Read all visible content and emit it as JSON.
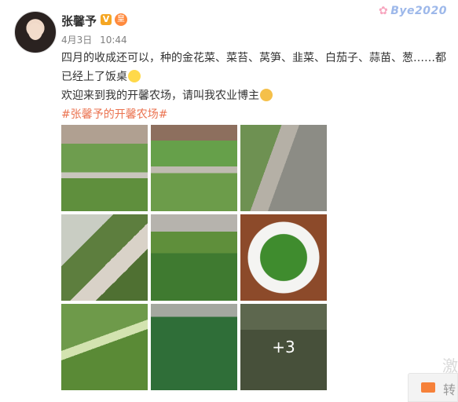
{
  "post": {
    "username": "张馨予",
    "verified_badge": "V",
    "member_badge": "皇",
    "date": "4月3日",
    "time": "10:44",
    "text_line1": "四月的收成还可以，种的金花菜、菜苔、莴笋、韭菜、白茄子、蒜苗、葱……都已经上了饭桌",
    "text_line2": "欢迎来到我的开馨农场，请叫我农业博主",
    "hashtag": "#张馨予的开馨农场#",
    "more_photos": "+3"
  },
  "top_right_logo": "Bye2020",
  "watermark_char": "激",
  "share_text": "转",
  "icons": [
    "avatar",
    "v-badge-icon",
    "member-badge-icon",
    "grin-emoji-icon",
    "cat-emoji-icon",
    "mail-icon"
  ],
  "colors": {
    "tag": "#eb7350",
    "meta": "#808080",
    "badge": "#f5a623"
  }
}
